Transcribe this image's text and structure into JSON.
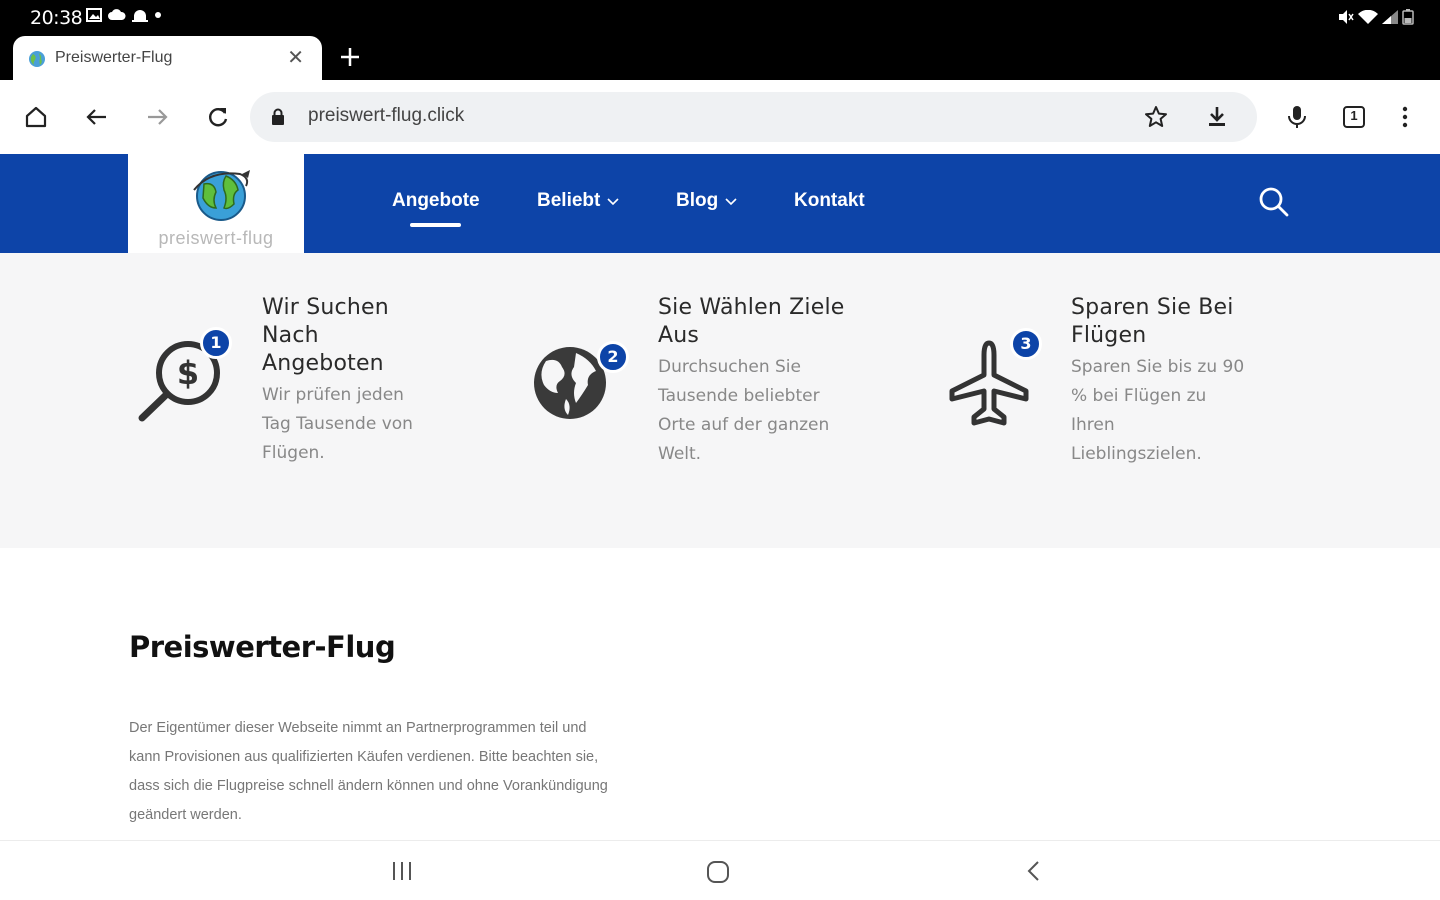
{
  "status_bar": {
    "time": "20:38",
    "left_icons": [
      "image-icon",
      "cloud-icon",
      "android-icon",
      "dot-icon"
    ],
    "right_icons": [
      "mute-icon",
      "wifi-icon",
      "signal-icon",
      "battery-icon"
    ]
  },
  "browser": {
    "tab_title": "Preiswerter-Flug",
    "url": "preiswert-flug.click",
    "tab_count": "1"
  },
  "site": {
    "logo_text": "preiswert-flug",
    "nav": [
      {
        "label": "Angebote",
        "active": true
      },
      {
        "label": "Beliebt",
        "dropdown": true
      },
      {
        "label": "Blog",
        "dropdown": true
      },
      {
        "label": "Kontakt"
      }
    ]
  },
  "features": [
    {
      "number": "1",
      "title": "Wir Suchen Nach Angeboten",
      "description": "Wir prüfen jeden Tag Tausende von Flügen.",
      "icon": "dollar-search-icon"
    },
    {
      "number": "2",
      "title": "Sie Wählen Ziele Aus",
      "description": "Durchsuchen Sie Tausende beliebter Orte auf der ganzen Welt.",
      "icon": "globe-icon"
    },
    {
      "number": "3",
      "title": "Sparen Sie Bei Flügen",
      "description": "Sparen Sie bis zu 90 % bei Flügen zu Ihren Lieblingszielen.",
      "icon": "airplane-icon"
    }
  ],
  "content": {
    "title": "Preiswerter-Flug",
    "text": "Der Eigentümer dieser Webseite nimmt an Partnerprogrammen teil und kann Provisionen aus qualifizierten Käufen verdienen. Bitte beachten sie, dass sich die Flugpreise schnell ändern können und ohne Vorankündigung geändert werden."
  },
  "colors": {
    "brand_blue": "#0d44a8",
    "feature_bg": "#f6f6f7"
  }
}
